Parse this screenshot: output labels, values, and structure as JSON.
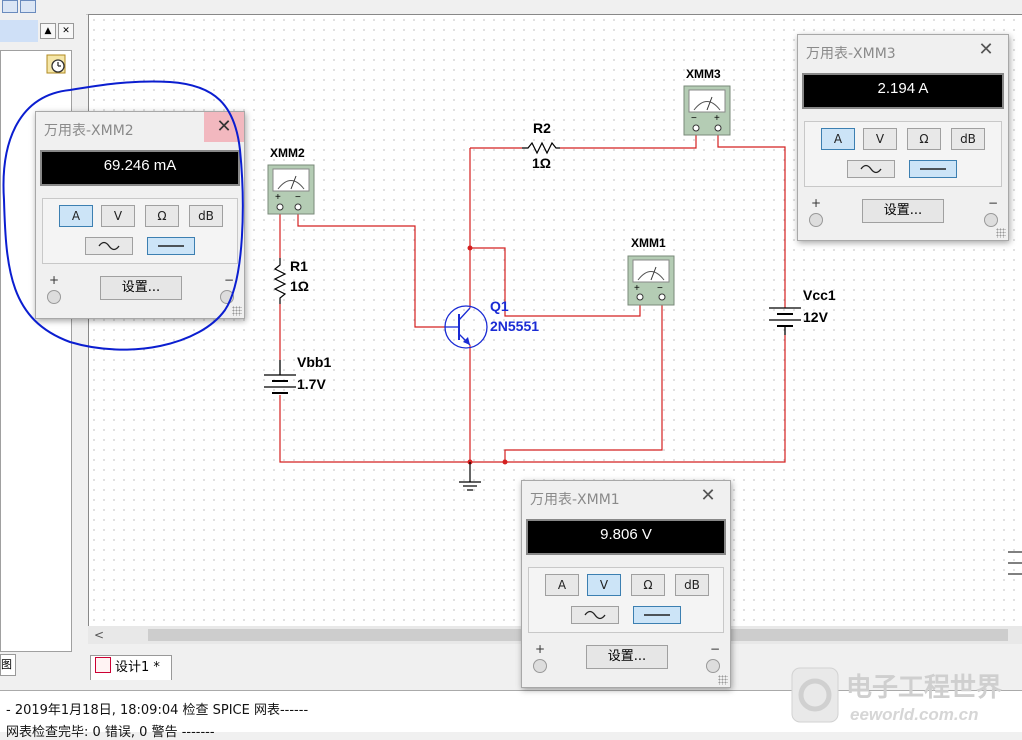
{
  "colors": {
    "wire": "#d42020",
    "bjt": "#1a2bd4",
    "annotation": "#0b1ed0",
    "meter_face": "#b4ccb4"
  },
  "canvas": {
    "components": {
      "r1": {
        "ref": "R1",
        "value": "1Ω"
      },
      "r2": {
        "ref": "R2",
        "value": "1Ω"
      },
      "q1": {
        "ref": "Q1",
        "model": "2N5551"
      },
      "vbb1": {
        "ref": "Vbb1",
        "value": "1.7V"
      },
      "vcc1": {
        "ref": "Vcc1",
        "value": "12V"
      },
      "xmm1": {
        "ref": "XMM1"
      },
      "xmm2": {
        "ref": "XMM2"
      },
      "xmm3": {
        "ref": "XMM3"
      }
    },
    "meter_plus": "+",
    "meter_minus": "−"
  },
  "dialogs": {
    "xmm2": {
      "title": "万用表-XMM2",
      "reading": "69.246 mA",
      "active_mode": "A"
    },
    "xmm3": {
      "title": "万用表-XMM3",
      "reading": "2.194 A",
      "active_mode": "A"
    },
    "xmm1": {
      "title": "万用表-XMM1",
      "reading": "9.806 V",
      "active_mode": "V"
    },
    "mode_labels": {
      "a": "A",
      "v": "V",
      "ohm": "Ω",
      "db": "dB"
    },
    "settings_label": "设置...",
    "plus": "+",
    "minus": "−",
    "close": "✕"
  },
  "left_panel": {
    "min_btn": "▲",
    "close_btn": "✕",
    "tab_fragment": "图"
  },
  "tabs": [
    {
      "label": "设计1 *"
    }
  ],
  "console": {
    "line1": " - 2019年1月18日, 18:09:04 检查 SPICE 网表------",
    "line2": "网表检查完毕: 0 错误, 0 警告 -------"
  },
  "watermark": {
    "cn": "电子工程世界",
    "en": "eeworld.com.cn"
  }
}
